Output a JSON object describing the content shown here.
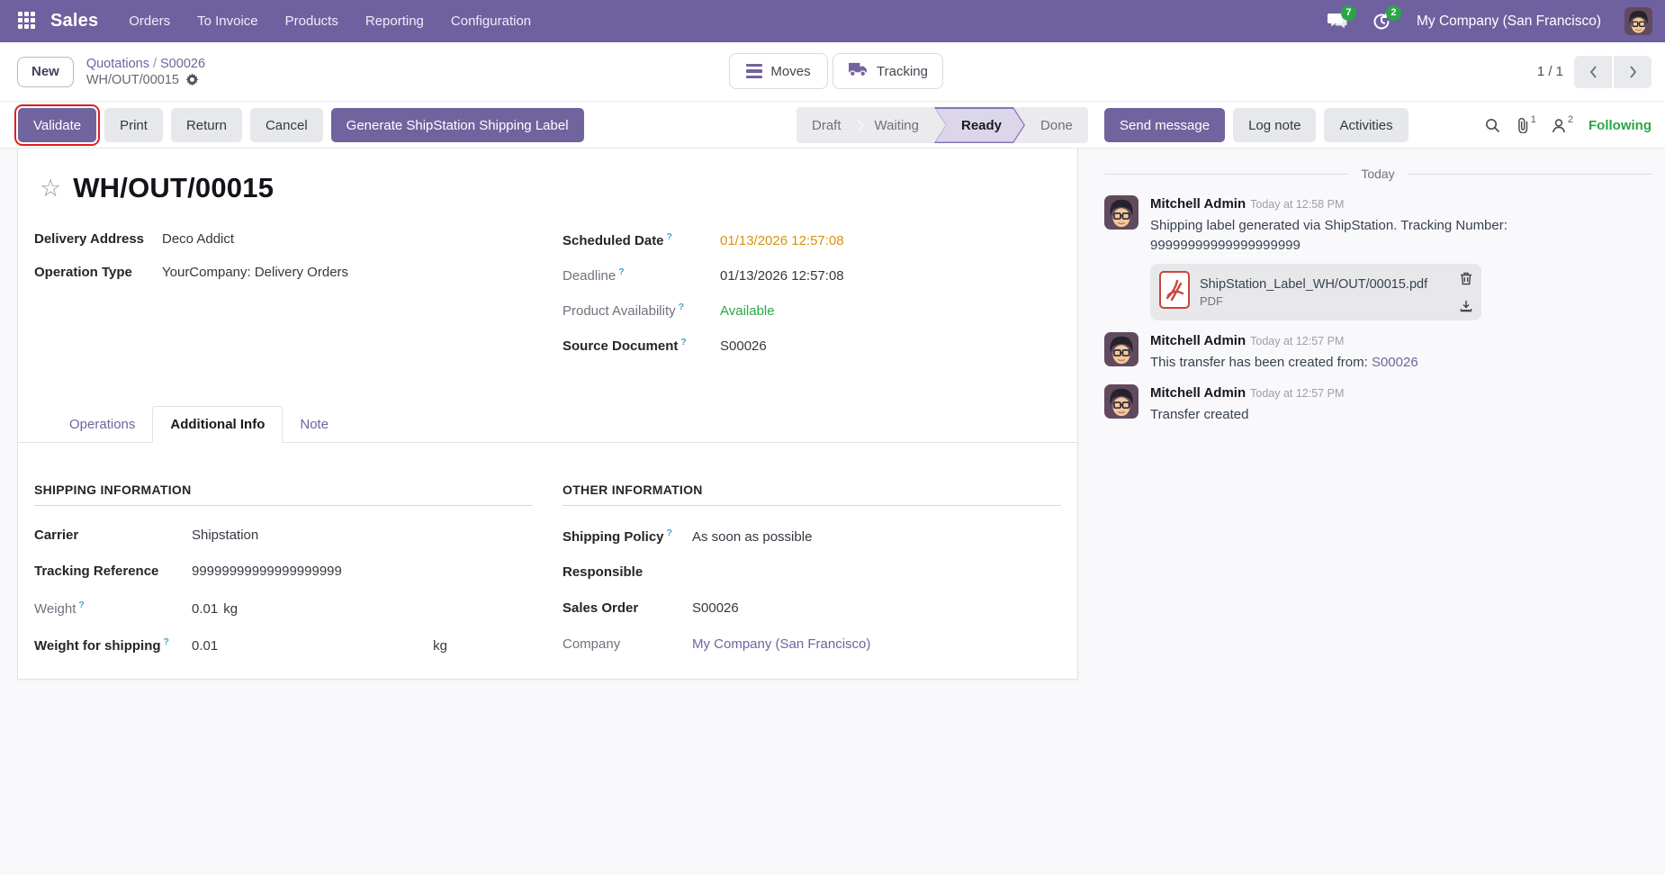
{
  "colors": {
    "accent": "#71639e",
    "date_warning": "#d8920e",
    "success": "#28a745",
    "highlight_box": "#e0201f"
  },
  "navbar": {
    "brand": "Sales",
    "menus": [
      "Orders",
      "To Invoice",
      "Products",
      "Reporting",
      "Configuration"
    ],
    "messages_count": "7",
    "activities_count": "2",
    "company": "My Company (San Francisco)"
  },
  "control_panel": {
    "new_label": "New",
    "breadcrumb_1": "Quotations",
    "breadcrumb_sep": "/",
    "breadcrumb_2": "S00026",
    "current_record": "WH/OUT/00015",
    "moves_label": "Moves",
    "tracking_label": "Tracking",
    "pager": "1 / 1"
  },
  "actions": {
    "validate": "Validate",
    "print": "Print",
    "return": "Return",
    "cancel": "Cancel",
    "generate": "Generate ShipStation Shipping Label"
  },
  "statusbar": {
    "stages": [
      "Draft",
      "Waiting",
      "Ready",
      "Done"
    ],
    "active_stage": "Ready"
  },
  "chatter": {
    "send_message": "Send message",
    "log_note": "Log note",
    "activities": "Activities",
    "attachments_count": "1",
    "followers_count": "2",
    "following": "Following",
    "date_divider": "Today",
    "messages": [
      {
        "author": "Mitchell Admin",
        "time": "Today at 12:58 PM",
        "body": "Shipping label generated via ShipStation. Tracking Number: 99999999999999999999",
        "attachment_name": "ShipStation_Label_WH/OUT/00015.pdf",
        "attachment_type": "PDF"
      },
      {
        "author": "Mitchell Admin",
        "time": "Today at 12:57 PM",
        "body": "This transfer has been created from:",
        "link": "S00026"
      },
      {
        "author": "Mitchell Admin",
        "time": "Today at 12:57 PM",
        "body": "Transfer created"
      }
    ]
  },
  "form": {
    "title": "WH/OUT/00015",
    "help_marker": "?",
    "delivery_address_label": "Delivery Address",
    "delivery_address": "Deco Addict",
    "operation_type_label": "Operation Type",
    "operation_type": "YourCompany: Delivery Orders",
    "scheduled_date_label": "Scheduled Date",
    "scheduled_date": "01/13/2026 12:57:08",
    "deadline_label": "Deadline",
    "deadline": "01/13/2026 12:57:08",
    "product_availability_label": "Product Availability",
    "product_availability": "Available",
    "source_document_label": "Source Document",
    "source_document": "S00026",
    "tabs": [
      "Operations",
      "Additional Info",
      "Note"
    ],
    "active_tab": "Additional Info",
    "shipping_section_title": "SHIPPING INFORMATION",
    "carrier_label": "Carrier",
    "carrier": "Shipstation",
    "tracking_ref_label": "Tracking Reference",
    "tracking_ref": "99999999999999999999",
    "weight_label": "Weight",
    "weight": "0.01",
    "weight_unit": "kg",
    "weight_shipping_label": "Weight for shipping",
    "weight_shipping": "0.01",
    "weight_shipping_unit": "kg",
    "other_section_title": "OTHER INFORMATION",
    "shipping_policy_label": "Shipping Policy",
    "shipping_policy": "As soon as possible",
    "responsible_label": "Responsible",
    "responsible": "",
    "sales_order_label": "Sales Order",
    "sales_order": "S00026",
    "company_label": "Company",
    "company": "My Company (San Francisco)"
  }
}
